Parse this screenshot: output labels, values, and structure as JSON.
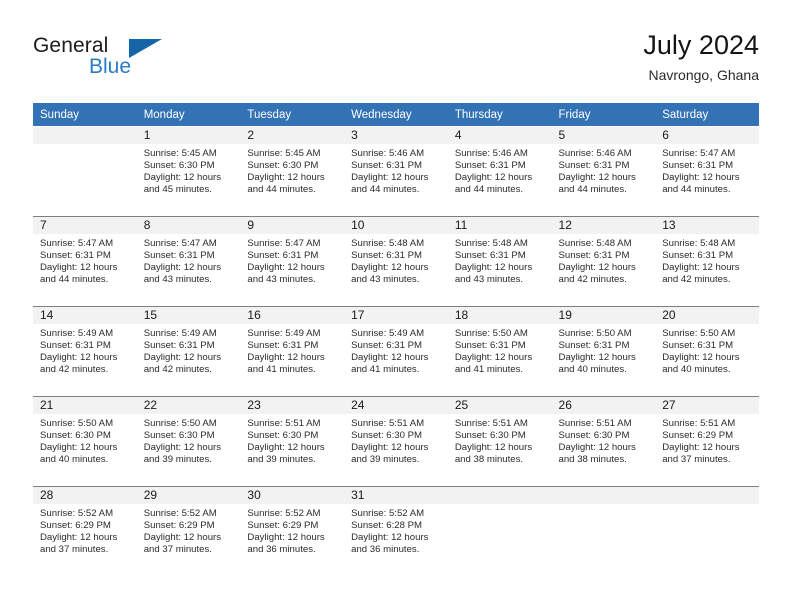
{
  "brand": {
    "name_part1": "General",
    "name_part2": "Blue",
    "triangle_color": "#1565a8",
    "blue_text_color": "#2b7cc4"
  },
  "header": {
    "title": "July 2024",
    "subtitle": "Navrongo, Ghana",
    "header_bg_color": "#3372b5",
    "daynum_bg_color": "#f2f2f2"
  },
  "weekdays": [
    "Sunday",
    "Monday",
    "Tuesday",
    "Wednesday",
    "Thursday",
    "Friday",
    "Saturday"
  ],
  "weeks": [
    [
      {
        "day": "",
        "sunrise": "",
        "sunset": "",
        "daylight_line1": "",
        "daylight_line2": ""
      },
      {
        "day": "1",
        "sunrise": "Sunrise: 5:45 AM",
        "sunset": "Sunset: 6:30 PM",
        "daylight_line1": "Daylight: 12 hours",
        "daylight_line2": "and 45 minutes."
      },
      {
        "day": "2",
        "sunrise": "Sunrise: 5:45 AM",
        "sunset": "Sunset: 6:30 PM",
        "daylight_line1": "Daylight: 12 hours",
        "daylight_line2": "and 44 minutes."
      },
      {
        "day": "3",
        "sunrise": "Sunrise: 5:46 AM",
        "sunset": "Sunset: 6:31 PM",
        "daylight_line1": "Daylight: 12 hours",
        "daylight_line2": "and 44 minutes."
      },
      {
        "day": "4",
        "sunrise": "Sunrise: 5:46 AM",
        "sunset": "Sunset: 6:31 PM",
        "daylight_line1": "Daylight: 12 hours",
        "daylight_line2": "and 44 minutes."
      },
      {
        "day": "5",
        "sunrise": "Sunrise: 5:46 AM",
        "sunset": "Sunset: 6:31 PM",
        "daylight_line1": "Daylight: 12 hours",
        "daylight_line2": "and 44 minutes."
      },
      {
        "day": "6",
        "sunrise": "Sunrise: 5:47 AM",
        "sunset": "Sunset: 6:31 PM",
        "daylight_line1": "Daylight: 12 hours",
        "daylight_line2": "and 44 minutes."
      }
    ],
    [
      {
        "day": "7",
        "sunrise": "Sunrise: 5:47 AM",
        "sunset": "Sunset: 6:31 PM",
        "daylight_line1": "Daylight: 12 hours",
        "daylight_line2": "and 44 minutes."
      },
      {
        "day": "8",
        "sunrise": "Sunrise: 5:47 AM",
        "sunset": "Sunset: 6:31 PM",
        "daylight_line1": "Daylight: 12 hours",
        "daylight_line2": "and 43 minutes."
      },
      {
        "day": "9",
        "sunrise": "Sunrise: 5:47 AM",
        "sunset": "Sunset: 6:31 PM",
        "daylight_line1": "Daylight: 12 hours",
        "daylight_line2": "and 43 minutes."
      },
      {
        "day": "10",
        "sunrise": "Sunrise: 5:48 AM",
        "sunset": "Sunset: 6:31 PM",
        "daylight_line1": "Daylight: 12 hours",
        "daylight_line2": "and 43 minutes."
      },
      {
        "day": "11",
        "sunrise": "Sunrise: 5:48 AM",
        "sunset": "Sunset: 6:31 PM",
        "daylight_line1": "Daylight: 12 hours",
        "daylight_line2": "and 43 minutes."
      },
      {
        "day": "12",
        "sunrise": "Sunrise: 5:48 AM",
        "sunset": "Sunset: 6:31 PM",
        "daylight_line1": "Daylight: 12 hours",
        "daylight_line2": "and 42 minutes."
      },
      {
        "day": "13",
        "sunrise": "Sunrise: 5:48 AM",
        "sunset": "Sunset: 6:31 PM",
        "daylight_line1": "Daylight: 12 hours",
        "daylight_line2": "and 42 minutes."
      }
    ],
    [
      {
        "day": "14",
        "sunrise": "Sunrise: 5:49 AM",
        "sunset": "Sunset: 6:31 PM",
        "daylight_line1": "Daylight: 12 hours",
        "daylight_line2": "and 42 minutes."
      },
      {
        "day": "15",
        "sunrise": "Sunrise: 5:49 AM",
        "sunset": "Sunset: 6:31 PM",
        "daylight_line1": "Daylight: 12 hours",
        "daylight_line2": "and 42 minutes."
      },
      {
        "day": "16",
        "sunrise": "Sunrise: 5:49 AM",
        "sunset": "Sunset: 6:31 PM",
        "daylight_line1": "Daylight: 12 hours",
        "daylight_line2": "and 41 minutes."
      },
      {
        "day": "17",
        "sunrise": "Sunrise: 5:49 AM",
        "sunset": "Sunset: 6:31 PM",
        "daylight_line1": "Daylight: 12 hours",
        "daylight_line2": "and 41 minutes."
      },
      {
        "day": "18",
        "sunrise": "Sunrise: 5:50 AM",
        "sunset": "Sunset: 6:31 PM",
        "daylight_line1": "Daylight: 12 hours",
        "daylight_line2": "and 41 minutes."
      },
      {
        "day": "19",
        "sunrise": "Sunrise: 5:50 AM",
        "sunset": "Sunset: 6:31 PM",
        "daylight_line1": "Daylight: 12 hours",
        "daylight_line2": "and 40 minutes."
      },
      {
        "day": "20",
        "sunrise": "Sunrise: 5:50 AM",
        "sunset": "Sunset: 6:31 PM",
        "daylight_line1": "Daylight: 12 hours",
        "daylight_line2": "and 40 minutes."
      }
    ],
    [
      {
        "day": "21",
        "sunrise": "Sunrise: 5:50 AM",
        "sunset": "Sunset: 6:30 PM",
        "daylight_line1": "Daylight: 12 hours",
        "daylight_line2": "and 40 minutes."
      },
      {
        "day": "22",
        "sunrise": "Sunrise: 5:50 AM",
        "sunset": "Sunset: 6:30 PM",
        "daylight_line1": "Daylight: 12 hours",
        "daylight_line2": "and 39 minutes."
      },
      {
        "day": "23",
        "sunrise": "Sunrise: 5:51 AM",
        "sunset": "Sunset: 6:30 PM",
        "daylight_line1": "Daylight: 12 hours",
        "daylight_line2": "and 39 minutes."
      },
      {
        "day": "24",
        "sunrise": "Sunrise: 5:51 AM",
        "sunset": "Sunset: 6:30 PM",
        "daylight_line1": "Daylight: 12 hours",
        "daylight_line2": "and 39 minutes."
      },
      {
        "day": "25",
        "sunrise": "Sunrise: 5:51 AM",
        "sunset": "Sunset: 6:30 PM",
        "daylight_line1": "Daylight: 12 hours",
        "daylight_line2": "and 38 minutes."
      },
      {
        "day": "26",
        "sunrise": "Sunrise: 5:51 AM",
        "sunset": "Sunset: 6:30 PM",
        "daylight_line1": "Daylight: 12 hours",
        "daylight_line2": "and 38 minutes."
      },
      {
        "day": "27",
        "sunrise": "Sunrise: 5:51 AM",
        "sunset": "Sunset: 6:29 PM",
        "daylight_line1": "Daylight: 12 hours",
        "daylight_line2": "and 37 minutes."
      }
    ],
    [
      {
        "day": "28",
        "sunrise": "Sunrise: 5:52 AM",
        "sunset": "Sunset: 6:29 PM",
        "daylight_line1": "Daylight: 12 hours",
        "daylight_line2": "and 37 minutes."
      },
      {
        "day": "29",
        "sunrise": "Sunrise: 5:52 AM",
        "sunset": "Sunset: 6:29 PM",
        "daylight_line1": "Daylight: 12 hours",
        "daylight_line2": "and 37 minutes."
      },
      {
        "day": "30",
        "sunrise": "Sunrise: 5:52 AM",
        "sunset": "Sunset: 6:29 PM",
        "daylight_line1": "Daylight: 12 hours",
        "daylight_line2": "and 36 minutes."
      },
      {
        "day": "31",
        "sunrise": "Sunrise: 5:52 AM",
        "sunset": "Sunset: 6:28 PM",
        "daylight_line1": "Daylight: 12 hours",
        "daylight_line2": "and 36 minutes."
      },
      {
        "day": "",
        "sunrise": "",
        "sunset": "",
        "daylight_line1": "",
        "daylight_line2": ""
      },
      {
        "day": "",
        "sunrise": "",
        "sunset": "",
        "daylight_line1": "",
        "daylight_line2": ""
      },
      {
        "day": "",
        "sunrise": "",
        "sunset": "",
        "daylight_line1": "",
        "daylight_line2": ""
      }
    ]
  ]
}
